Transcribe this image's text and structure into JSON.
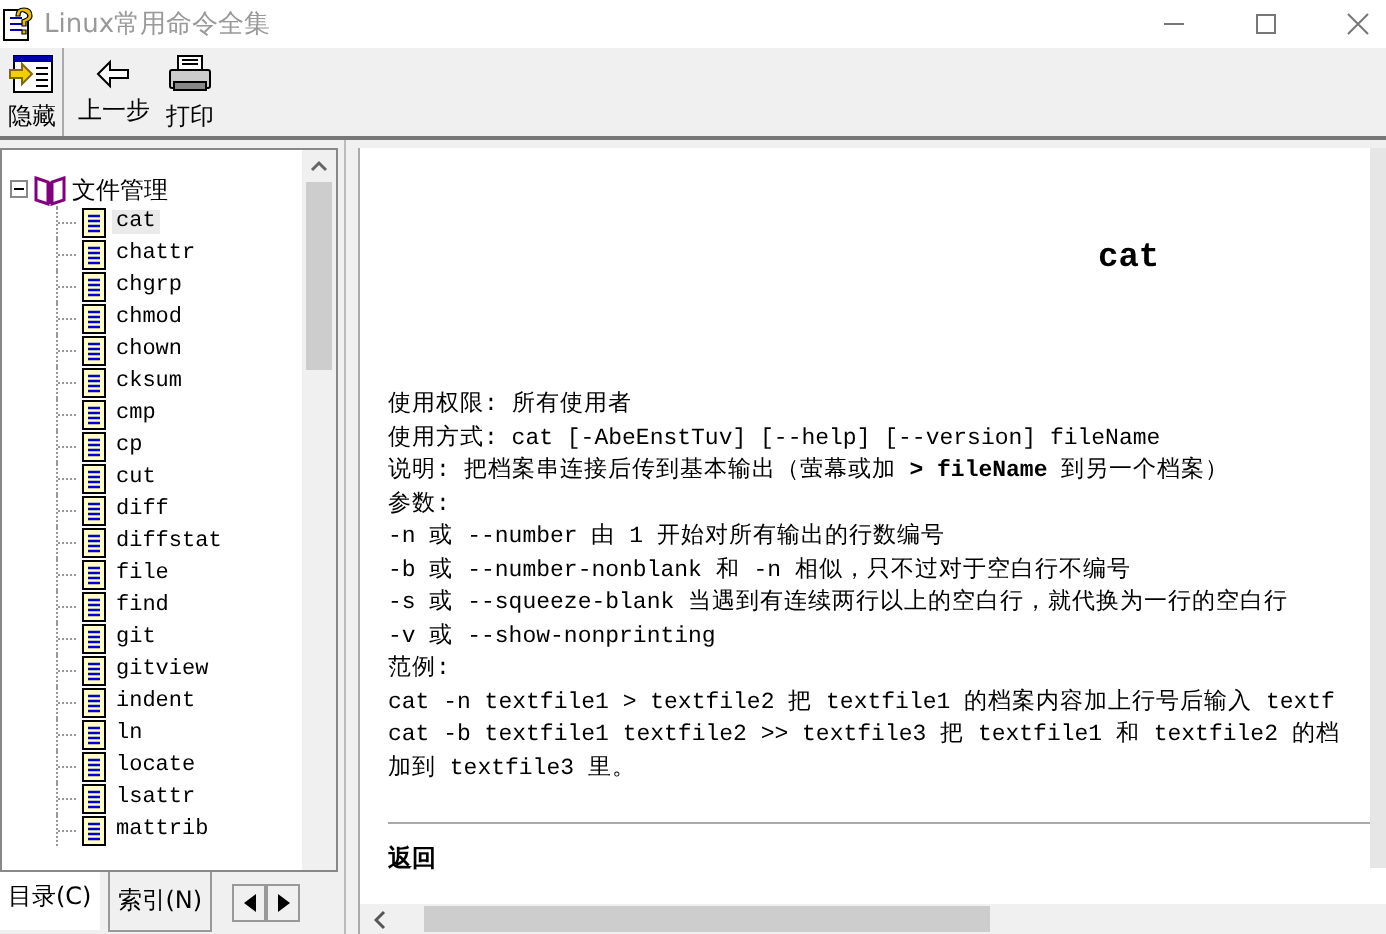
{
  "window": {
    "title": "Linux常用命令全集"
  },
  "toolbar": {
    "buttons": [
      {
        "label": "隐藏",
        "kind": "hide"
      },
      {
        "label": "上一步",
        "kind": "back"
      },
      {
        "label": "打印",
        "kind": "print"
      }
    ]
  },
  "tree": {
    "label": "文件管理",
    "expanded": true,
    "children": [
      {
        "label": "cat",
        "selected": true
      },
      {
        "label": "chattr",
        "selected": false
      },
      {
        "label": "chgrp",
        "selected": false
      },
      {
        "label": "chmod",
        "selected": false
      },
      {
        "label": "chown",
        "selected": false
      },
      {
        "label": "cksum",
        "selected": false
      },
      {
        "label": "cmp",
        "selected": false
      },
      {
        "label": "cp",
        "selected": false
      },
      {
        "label": "cut",
        "selected": false
      },
      {
        "label": "diff",
        "selected": false
      },
      {
        "label": "diffstat",
        "selected": false
      },
      {
        "label": "file",
        "selected": false
      },
      {
        "label": "find",
        "selected": false
      },
      {
        "label": "git",
        "selected": false
      },
      {
        "label": "gitview",
        "selected": false
      },
      {
        "label": "indent",
        "selected": false
      },
      {
        "label": "ln",
        "selected": false
      },
      {
        "label": "locate",
        "selected": false
      },
      {
        "label": "lsattr",
        "selected": false
      },
      {
        "label": "mattrib",
        "selected": false
      }
    ]
  },
  "tabs": [
    {
      "label": "目录(C)",
      "selected": true
    },
    {
      "label": "索引(N)",
      "selected": false
    }
  ],
  "content": {
    "title": "cat",
    "lines": [
      "使用权限: 所有使用者",
      "使用方式: cat [-AbeEnstTuv] [--help] [--version] fileName",
      "说明: 把档案串连接后传到基本输出（萤幕或加 **> fileName** 到另一个档案）",
      "参数:",
      "-n 或 --number 由 1 开始对所有输出的行数编号",
      "-b 或 --number-nonblank 和 -n 相似，只不过对于空白行不编号",
      "-s 或 --squeeze-blank 当遇到有连续两行以上的空白行，就代换为一行的空白行",
      "-v 或 --show-nonprinting",
      "范例:",
      "cat -n textfile1 > textfile2 把 textfile1 的档案内容加上行号后输入 textf",
      "cat -b textfile1 textfile2 >> textfile3 把 textfile1 和 textfile2 的档",
      "加到 textfile3 里。"
    ],
    "link": "返回"
  }
}
